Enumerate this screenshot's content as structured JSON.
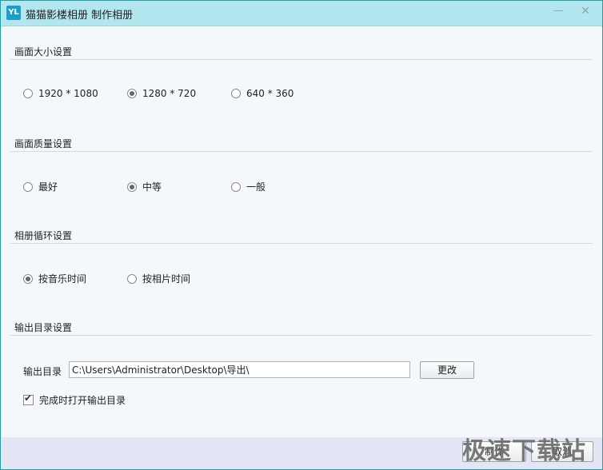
{
  "window": {
    "icon_text": "YL",
    "title": "猫猫影楼相册 制作相册",
    "minimize_glyph": "—",
    "close_glyph": "✕"
  },
  "sections": {
    "size": {
      "title": "画面大小设置",
      "options": [
        "1920 * 1080",
        "1280 * 720",
        "640 * 360"
      ],
      "selected": "1280 * 720"
    },
    "quality": {
      "title": "画面质量设置",
      "options": [
        "最好",
        "中等",
        "一般"
      ],
      "selected": "中等"
    },
    "loop": {
      "title": "相册循环设置",
      "options": [
        "按音乐时间",
        "按相片时间"
      ],
      "selected": "按音乐时间"
    },
    "output": {
      "title": "输出目录设置",
      "label": "输出目录",
      "path": "C:\\Users\\Administrator\\Desktop\\导出\\",
      "change_button": "更改",
      "open_on_finish_label": "完成时打开输出目录",
      "open_on_finish_checked": true
    }
  },
  "footer": {
    "button1": "制作",
    "button2": "取消"
  },
  "watermark": "极速下载站",
  "colors": {
    "titlebar": "#b4e6ef",
    "border": "#1e9fa0",
    "footer": "#e4e6f6"
  }
}
